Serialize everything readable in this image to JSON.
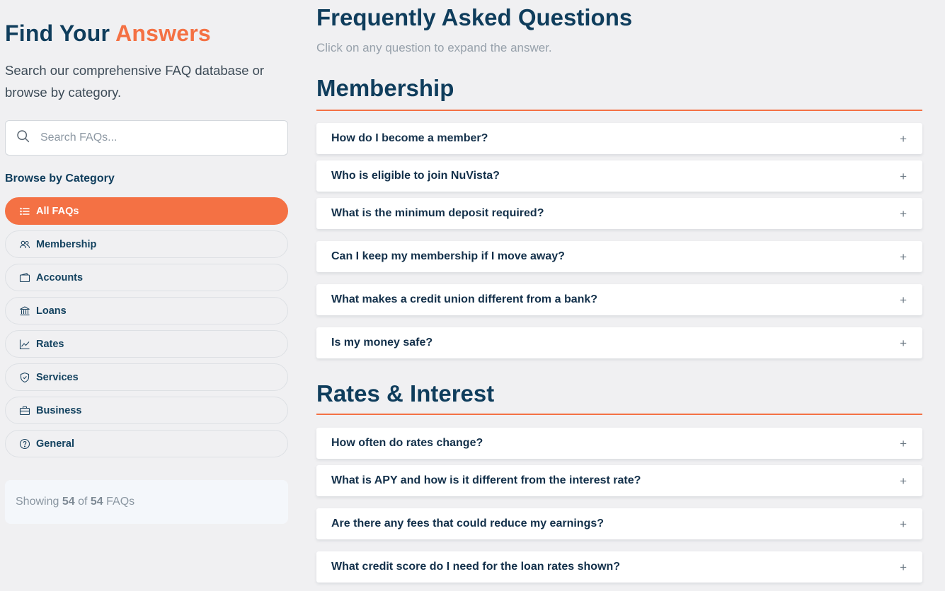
{
  "sidebar": {
    "title_prefix": "Find Your",
    "title_accent": "Answers",
    "description": "Search our comprehensive FAQ database or browse by category.",
    "search_placeholder": "Search FAQs...",
    "browse_heading": "Browse by Category",
    "categories": [
      {
        "label": "All FAQs",
        "icon": "list-icon",
        "active": true
      },
      {
        "label": "Membership",
        "icon": "users-icon",
        "active": false
      },
      {
        "label": "Accounts",
        "icon": "wallet-icon",
        "active": false
      },
      {
        "label": "Loans",
        "icon": "bank-icon",
        "active": false
      },
      {
        "label": "Rates",
        "icon": "trend-chart-icon",
        "active": false
      },
      {
        "label": "Services",
        "icon": "shield-icon",
        "active": false
      },
      {
        "label": "Business",
        "icon": "briefcase-icon",
        "active": false
      },
      {
        "label": "General",
        "icon": "question-circle-icon",
        "active": false
      }
    ],
    "count": {
      "prefix": "Showing",
      "shown": "54",
      "of": "of",
      "total": "54",
      "suffix": "FAQs"
    }
  },
  "main": {
    "title": "Frequently Asked Questions",
    "subtitle": "Click on any question to expand the answer.",
    "expand_symbol": "+",
    "sections": [
      {
        "title": "Membership",
        "questions": [
          "How do I become a member?",
          "Who is eligible to join NuVista?",
          "What is the minimum deposit required?",
          "Can I keep my membership if I move away?",
          "What makes a credit union different from a bank?",
          "Is my money safe?"
        ]
      },
      {
        "title": "Rates & Interest",
        "questions": [
          "How often do rates change?",
          "What is APY and how is it different from the interest rate?",
          "Are there any fees that could reduce my earnings?",
          "What credit score do I need for the loan rates shown?"
        ]
      }
    ]
  },
  "colors": {
    "navy": "#0f3d5c",
    "accent": "#f47144",
    "background": "#f0f0f2"
  }
}
